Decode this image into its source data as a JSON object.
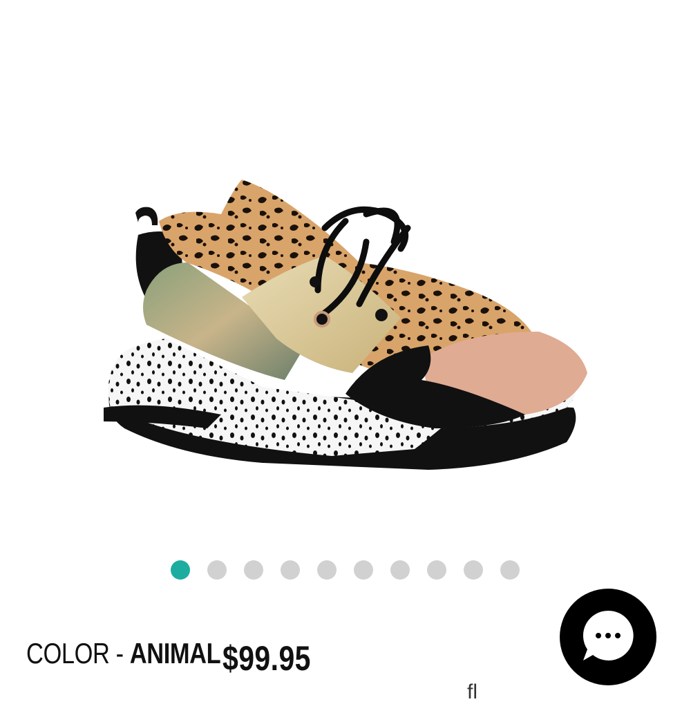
{
  "product": {
    "image_alt": "Animal print chunky sneaker",
    "color_label": "COLOR - ",
    "color_value": "ANIMAL",
    "price": "$99.95"
  },
  "carousel": {
    "total": 10,
    "active_index": 0,
    "active_color": "#1cada0",
    "inactive_color": "#d1d1d1"
  },
  "chat": {
    "icon": "chat-bubble-ellipsis-icon",
    "dots": "···"
  },
  "footer_partial": "fl"
}
